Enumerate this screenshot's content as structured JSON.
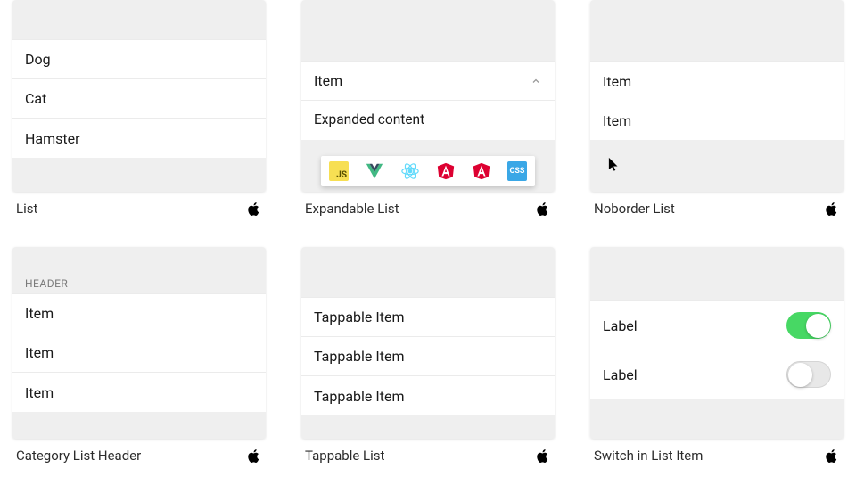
{
  "cards": {
    "list": {
      "caption": "List",
      "items": [
        "Dog",
        "Cat",
        "Hamster"
      ]
    },
    "expandable": {
      "caption": "Expandable List",
      "header_item": "Item",
      "expanded_content": "Expanded content",
      "tech_icons": [
        "js",
        "vue",
        "react",
        "angular",
        "angular2",
        "css"
      ]
    },
    "noborder": {
      "caption": "Noborder List",
      "items": [
        "Item",
        "Item"
      ]
    },
    "category": {
      "caption": "Category List Header",
      "header": "HEADER",
      "items": [
        "Item",
        "Item",
        "Item"
      ]
    },
    "tappable": {
      "caption": "Tappable List",
      "items": [
        "Tappable Item",
        "Tappable Item",
        "Tappable Item"
      ]
    },
    "switch": {
      "caption": "Switch in List Item",
      "rows": [
        {
          "label": "Label",
          "on": true
        },
        {
          "label": "Label",
          "on": false
        }
      ]
    }
  },
  "tech_labels": {
    "js": "JS",
    "css": "CSS"
  }
}
